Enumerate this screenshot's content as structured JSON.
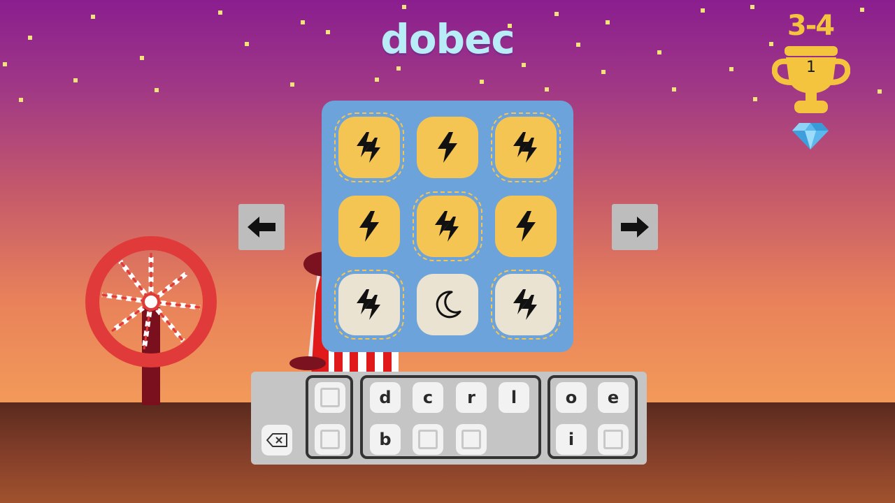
{
  "colors": {
    "sky_top": "#8a1e8f",
    "sky_bottom": "#f29a5a",
    "ground": "#86402a",
    "board": "#6ba3da",
    "tile_yellow": "#f5c553",
    "tile_beige": "#ebe3d1",
    "title": "#b8ecf6",
    "level": "#f5c43e"
  },
  "header": {
    "word": "dobec",
    "level": "3-4",
    "trophy_count": "1"
  },
  "board": {
    "tiles": [
      {
        "icon": "double-lightning-icon",
        "color": "yellow",
        "dashed": true
      },
      {
        "icon": "lightning-icon",
        "color": "yellow",
        "dashed": false
      },
      {
        "icon": "double-lightning-icon",
        "color": "yellow",
        "dashed": true
      },
      {
        "icon": "lightning-icon",
        "color": "yellow",
        "dashed": false
      },
      {
        "icon": "double-lightning-icon",
        "color": "yellow",
        "dashed": true
      },
      {
        "icon": "lightning-icon",
        "color": "yellow",
        "dashed": false
      },
      {
        "icon": "double-lightning-icon",
        "color": "beige",
        "dashed": true
      },
      {
        "icon": "moon-icon",
        "color": "beige",
        "dashed": false
      },
      {
        "icon": "double-lightning-icon",
        "color": "beige",
        "dashed": true
      }
    ]
  },
  "nav": {
    "prev_icon": "arrow-left-icon",
    "next_icon": "arrow-right-icon"
  },
  "keyboard": {
    "backspace_icon": "backspace-icon",
    "group1": [
      "",
      ""
    ],
    "group2": [
      "d",
      "c",
      "r",
      "l",
      "b",
      "",
      ""
    ],
    "group3": [
      "o",
      "e",
      "i",
      ""
    ]
  }
}
